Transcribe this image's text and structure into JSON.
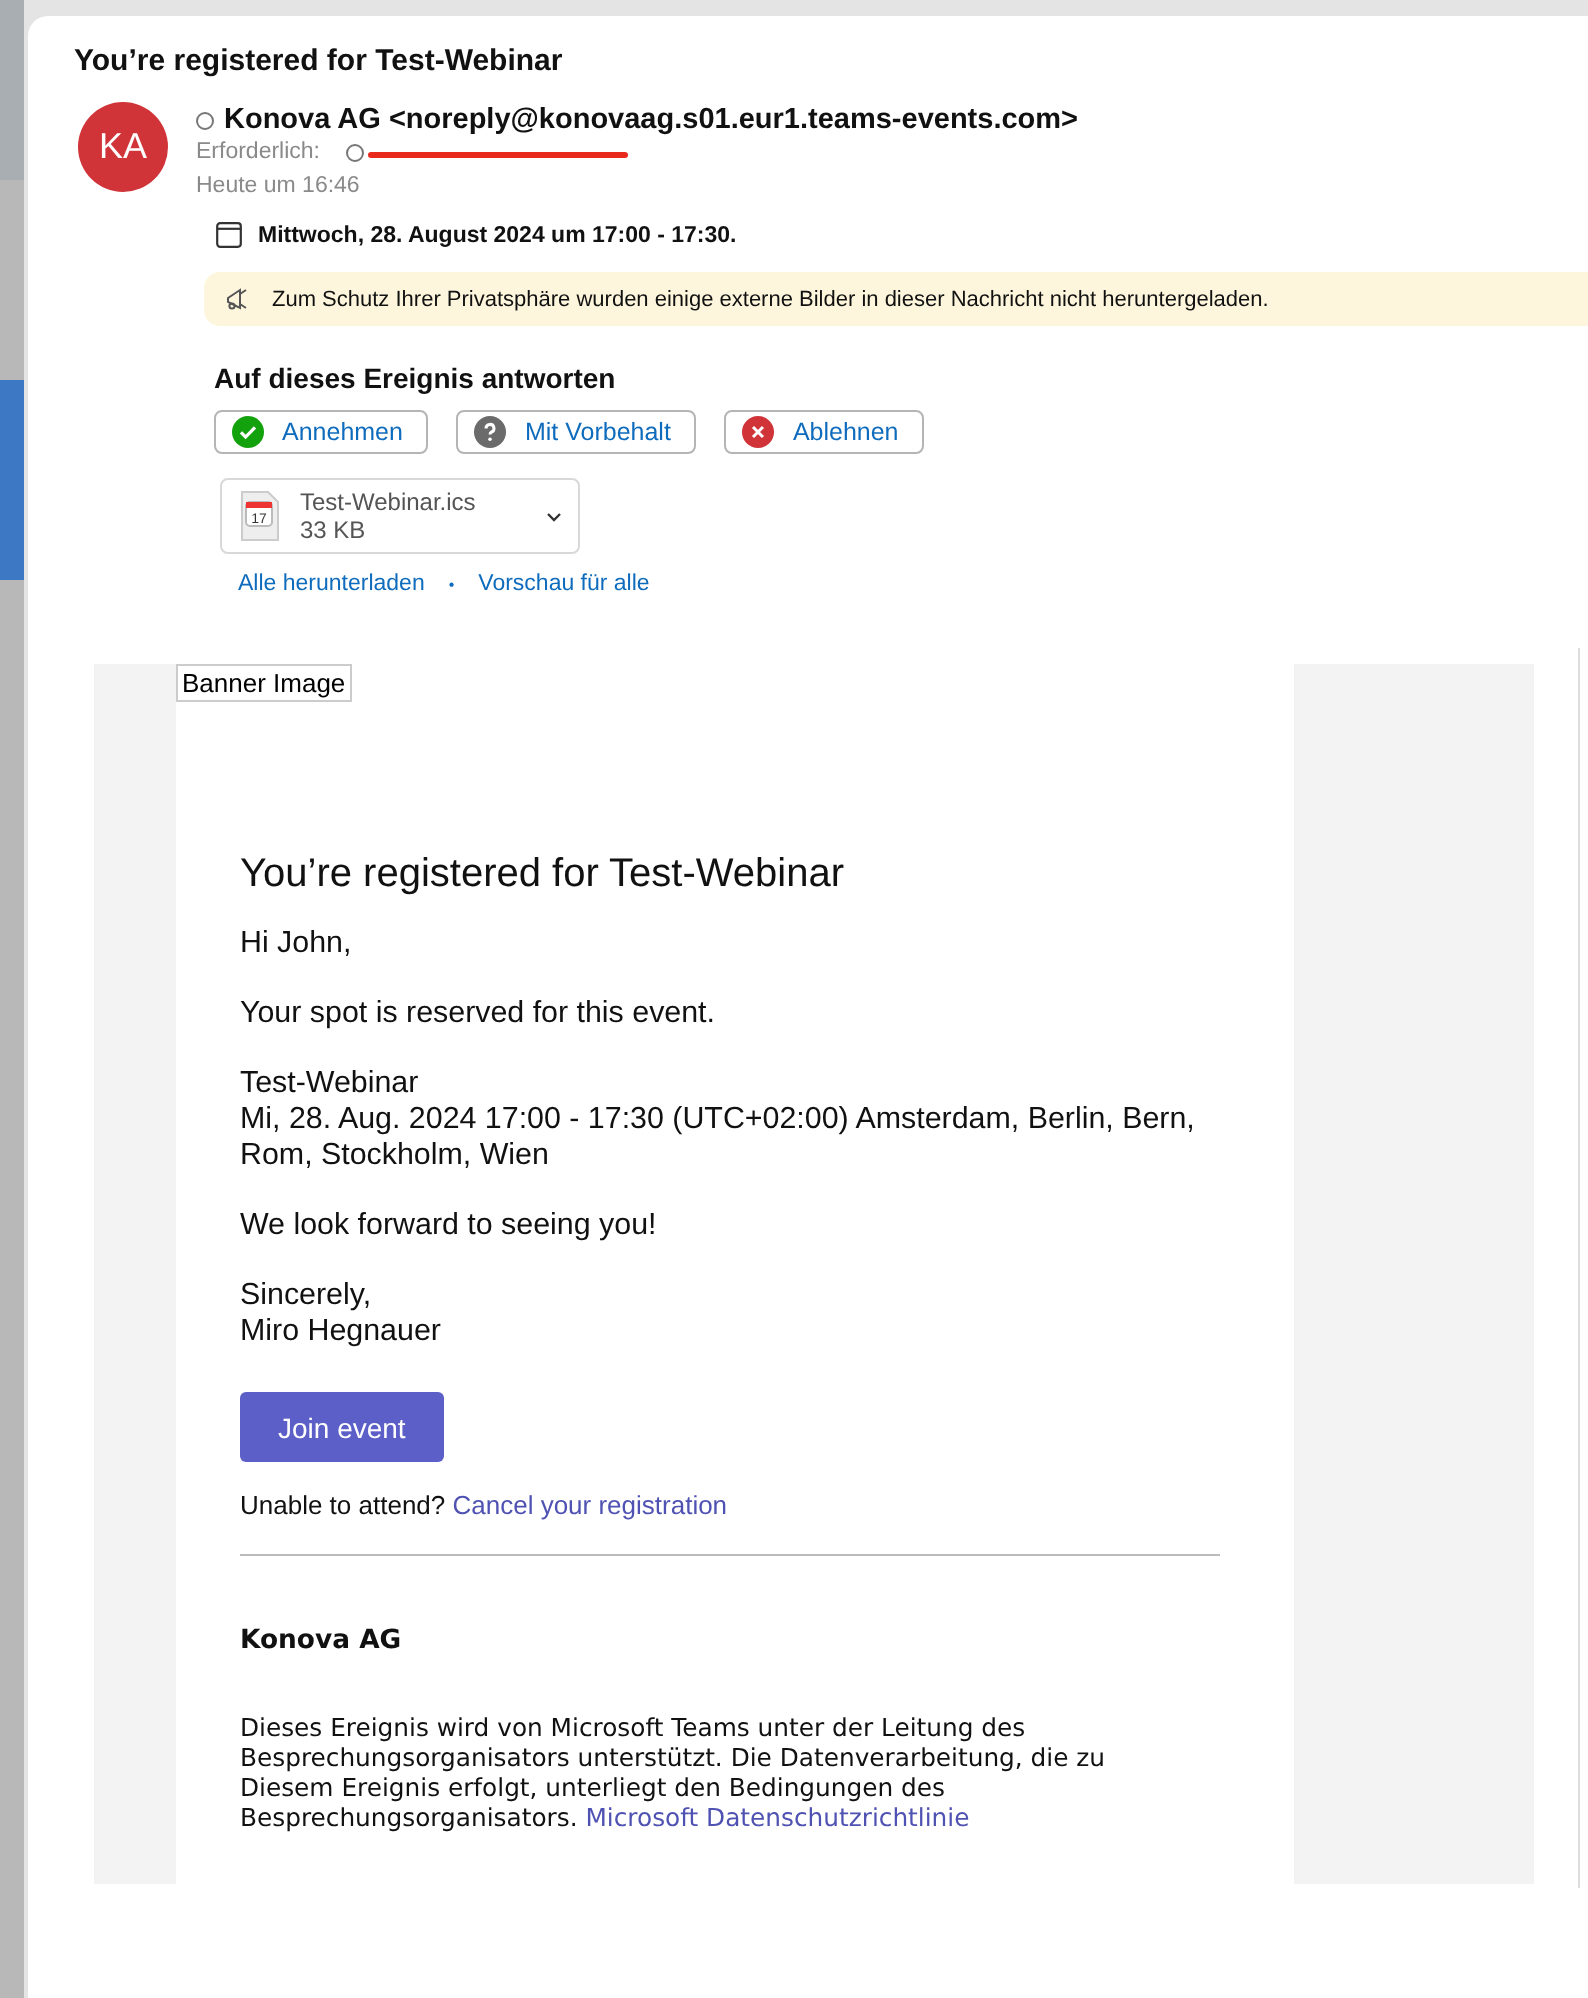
{
  "window": {
    "title": "You’re registered for Test-Webinar"
  },
  "sender": {
    "initials": "KA",
    "name": "Konova AG <noreply@konovaag.s01.eur1.teams-events.com>",
    "required_label": "Erforderlich:",
    "time": "Heute um 16:46"
  },
  "event_time": "Mittwoch, 28. August 2024 um 17:00 - 17:30.",
  "privacy_notice": "Zum Schutz Ihrer Privatsphäre wurden einige externe Bilder in dieser Nachricht nicht heruntergeladen.",
  "rsvp": {
    "heading": "Auf dieses Ereignis antworten",
    "buttons": [
      {
        "kind": "accept",
        "label": "Annehmen"
      },
      {
        "kind": "tentative",
        "label": "Mit Vorbehalt"
      },
      {
        "kind": "decline",
        "label": "Ablehnen"
      }
    ]
  },
  "attachment": {
    "name": "Test-Webinar.ics",
    "size": "33 KB",
    "calendar_day": "17"
  },
  "attachment_links": {
    "download_all": "Alle herunterladen",
    "separator": "•",
    "preview_all": "Vorschau für alle"
  },
  "email": {
    "banner_alt": "Banner Image",
    "heading": "You’re registered for Test-Webinar",
    "blocks": [
      [
        "Hi John,"
      ],
      [
        "Your spot is reserved for this event."
      ],
      [
        "Test-Webinar",
        "Mi, 28. Aug. 2024 17:00 - 17:30 (UTC+02:00) Amsterdam, Berlin, Bern, Rom, Stockholm, Wien"
      ],
      [
        "We look forward to seeing you!"
      ],
      [
        "Sincerely,",
        "Miro Hegnauer"
      ]
    ],
    "join_button": "Join event",
    "cancel_prompt": "Unable to attend?",
    "cancel_link": "Cancel your registration",
    "org_name": "Konova AG",
    "footer_text": "Dieses Ereignis wird von Microsoft Teams unter der Leitung des Besprechungsorganisators unterstützt. Die Datenverarbeitung, die zu Diesem Ereignis erfolgt, unterliegt den Bedingungen des Besprechungsorganisators.",
    "footer_link": "Microsoft Datenschutzrichtlinie"
  }
}
